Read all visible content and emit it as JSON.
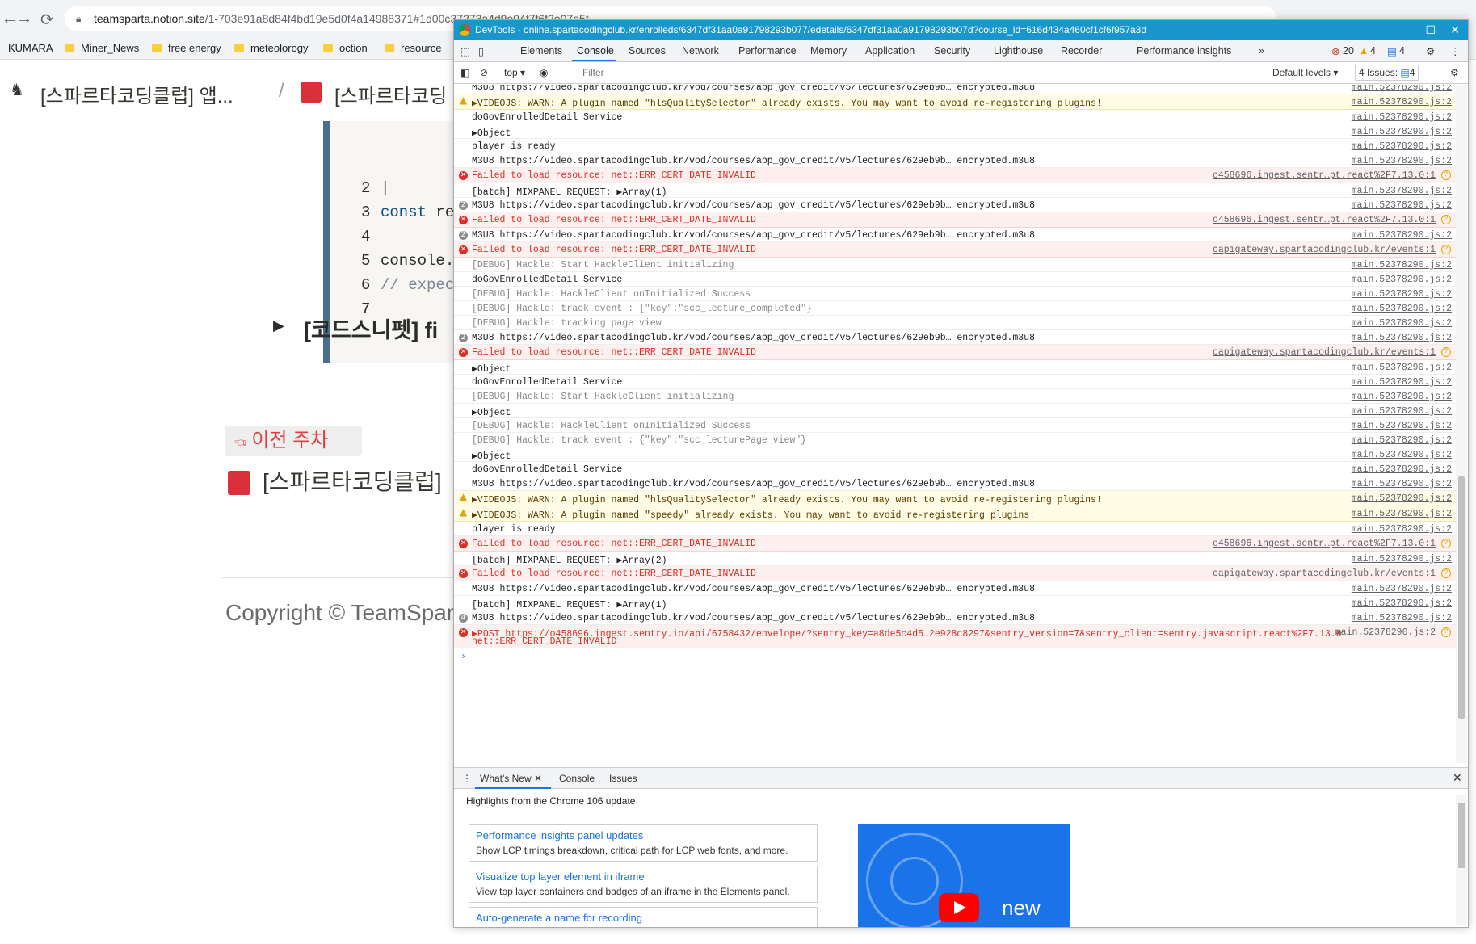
{
  "browser": {
    "url_host": "teamsparta.notion.site",
    "url_rest": "/1-703e91a8d84f4bd19e5d0f4a14988371#1d00c37273a4d9e94f7f6f2e07e5f",
    "bookmarks": [
      "KUMARA",
      "Miner_News",
      "free energy",
      "meteolorogy",
      "oction",
      "resource"
    ]
  },
  "notion": {
    "breadcrumb_1": "[스파르타코딩클럽] 앱...",
    "breadcrumb_sep": "/",
    "breadcrumb_2": "[스파르타코딩",
    "code_lines": [
      {
        "num": "2",
        "text": "|"
      },
      {
        "num": "3",
        "kw": "const",
        "text": " re"
      },
      {
        "num": "4",
        "text": ""
      },
      {
        "num": "5",
        "text": "console."
      },
      {
        "num": "6",
        "comment": "// expec"
      },
      {
        "num": "7",
        "text": ""
      }
    ],
    "toggle_text": "[코드스니펫] fi",
    "prev_week": "이전 주차",
    "prev_link": "[스파르타코딩클럽]",
    "copyright": "Copyright © TeamSpar"
  },
  "devtools": {
    "title": "DevTools - online.spartacodingclub.kr/enrolleds/6347df31aa0a91798293b077/edetails/6347df31aa0a91798293b07d?course_id=616d434a460cf1cf6f957a3d",
    "tabs": [
      "Elements",
      "Console",
      "Sources",
      "Network",
      "Performance",
      "Memory",
      "Application",
      "Security",
      "Lighthouse",
      "Recorder",
      "Performance insights"
    ],
    "more_tabs": "»",
    "error_count": "20",
    "warn_count": "4",
    "info_count": "4",
    "context": "top",
    "filter_placeholder": "Filter",
    "levels": "Default levels",
    "issues": "4 Issues:",
    "issues_count": "4",
    "rows": [
      {
        "type": "log",
        "text": "M3U8 https://video.spartacodingclub.kr/vod/courses/app_gov_credit/v5/lectures/629eb9b… encrypted.m3u8",
        "src": "main.52378290.js:2"
      },
      {
        "type": "warn",
        "text": "▶VIDEOJS: WARN: A plugin named \"hlsQualitySelector\" already exists. You may want to avoid re-registering plugins!",
        "src": "main.52378290.js:2"
      },
      {
        "type": "log",
        "text": "doGovEnrolledDetail Service",
        "src": "main.52378290.js:2"
      },
      {
        "type": "log",
        "text": "▶Object",
        "src": "main.52378290.js:2"
      },
      {
        "type": "log",
        "text": "player is ready",
        "src": "main.52378290.js:2"
      },
      {
        "type": "log",
        "text": "M3U8 https://video.spartacodingclub.kr/vod/courses/app_gov_credit/v5/lectures/629eb9b… encrypted.m3u8",
        "src": "main.52378290.js:2"
      },
      {
        "type": "err",
        "text": "Failed to load resource: net::ERR_CERT_DATE_INVALID",
        "src": "o458696.ingest.sentr…pt.react%2F7.13.0:1"
      },
      {
        "type": "log",
        "text": "[batch] MIXPANEL REQUEST: ▶Array(1)",
        "src": "main.52378290.js:2"
      },
      {
        "type": "log",
        "count": "2",
        "text": "M3U8 https://video.spartacodingclub.kr/vod/courses/app_gov_credit/v5/lectures/629eb9b… encrypted.m3u8",
        "src": "main.52378290.js:2"
      },
      {
        "type": "err",
        "text": "Failed to load resource: net::ERR_CERT_DATE_INVALID",
        "src": "o458696.ingest.sentr…pt.react%2F7.13.0:1"
      },
      {
        "type": "log",
        "count": "2",
        "text": "M3U8 https://video.spartacodingclub.kr/vod/courses/app_gov_credit/v5/lectures/629eb9b… encrypted.m3u8",
        "src": "main.52378290.js:2"
      },
      {
        "type": "err",
        "text": "Failed to load resource: net::ERR_CERT_DATE_INVALID",
        "src": "capigateway.spartacodingclub.kr/events:1"
      },
      {
        "type": "dbg",
        "text": "[DEBUG] Hackle: Start HackleClient initializing",
        "src": "main.52378290.js:2"
      },
      {
        "type": "log",
        "text": "doGovEnrolledDetail Service",
        "src": "main.52378290.js:2"
      },
      {
        "type": "dbg",
        "text": "[DEBUG] Hackle: HackleClient onInitialized Success",
        "src": "main.52378290.js:2"
      },
      {
        "type": "dbg",
        "text": "[DEBUG] Hackle: track event : {\"key\":\"scc_lecture_completed\"}",
        "src": "main.52378290.js:2"
      },
      {
        "type": "dbg",
        "text": "[DEBUG] Hackle: tracking page view",
        "src": "main.52378290.js:2"
      },
      {
        "type": "log",
        "count": "2",
        "text": "M3U8 https://video.spartacodingclub.kr/vod/courses/app_gov_credit/v5/lectures/629eb9b… encrypted.m3u8",
        "src": "main.52378290.js:2"
      },
      {
        "type": "err",
        "text": "Failed to load resource: net::ERR_CERT_DATE_INVALID",
        "src": "capigateway.spartacodingclub.kr/events:1"
      },
      {
        "type": "log",
        "text": "▶Object",
        "src": "main.52378290.js:2"
      },
      {
        "type": "log",
        "text": "doGovEnrolledDetail Service",
        "src": "main.52378290.js:2"
      },
      {
        "type": "dbg",
        "text": "[DEBUG] Hackle: Start HackleClient initializing",
        "src": "main.52378290.js:2"
      },
      {
        "type": "log",
        "text": "▶Object",
        "src": "main.52378290.js:2"
      },
      {
        "type": "dbg",
        "text": "[DEBUG] Hackle: HackleClient onInitialized Success",
        "src": "main.52378290.js:2"
      },
      {
        "type": "dbg",
        "text": "[DEBUG] Hackle: track event : {\"key\":\"scc_lecturePage_view\"}",
        "src": "main.52378290.js:2"
      },
      {
        "type": "log",
        "text": "▶Object",
        "src": "main.52378290.js:2"
      },
      {
        "type": "log",
        "text": "doGovEnrolledDetail Service",
        "src": "main.52378290.js:2"
      },
      {
        "type": "log",
        "text": "M3U8 https://video.spartacodingclub.kr/vod/courses/app_gov_credit/v5/lectures/629eb9b… encrypted.m3u8",
        "src": "main.52378290.js:2"
      },
      {
        "type": "warn",
        "text": "▶VIDEOJS: WARN: A plugin named \"hlsQualitySelector\" already exists. You may want to avoid re-registering plugins!",
        "src": "main.52378290.js:2"
      },
      {
        "type": "warn",
        "text": "▶VIDEOJS: WARN: A plugin named \"speedy\" already exists. You may want to avoid re-registering plugins!",
        "src": "main.52378290.js:2"
      },
      {
        "type": "log",
        "text": "player is ready",
        "src": "main.52378290.js:2"
      },
      {
        "type": "err",
        "text": "Failed to load resource: net::ERR_CERT_DATE_INVALID",
        "src": "o458696.ingest.sentr…pt.react%2F7.13.0:1"
      },
      {
        "type": "log",
        "text": "[batch] MIXPANEL REQUEST: ▶Array(2)",
        "src": "main.52378290.js:2"
      },
      {
        "type": "err",
        "text": "Failed to load resource: net::ERR_CERT_DATE_INVALID",
        "src": "capigateway.spartacodingclub.kr/events:1"
      },
      {
        "type": "log",
        "text": "M3U8 https://video.spartacodingclub.kr/vod/courses/app_gov_credit/v5/lectures/629eb9b… encrypted.m3u8",
        "src": "main.52378290.js:2"
      },
      {
        "type": "log",
        "text": "[batch] MIXPANEL REQUEST: ▶Array(1)",
        "src": "main.52378290.js:2"
      },
      {
        "type": "log",
        "count": "4",
        "text": "M3U8 https://video.spartacodingclub.kr/vod/courses/app_gov_credit/v5/lectures/629eb9b… encrypted.m3u8",
        "src": "main.52378290.js:2"
      },
      {
        "type": "err",
        "tall": true,
        "text": "▶POST https://o458696.ingest.sentry.io/api/6758432/envelope/?sentry_key=a8de5c4d5…2e928c8297&sentry_version=7&sentry_client=sentry.javascript.react%2F7.13.0",
        "text2": "net::ERR_CERT_DATE_INVALID",
        "src": "main.52378290.js:2"
      }
    ],
    "drawer_tabs": [
      "What's New",
      "Console",
      "Issues"
    ],
    "highlights": "Highlights from the Chrome 106 update",
    "cards": [
      {
        "title": "Performance insights panel updates",
        "desc": "Show LCP timings breakdown, critical path for LCP web fonts, and more."
      },
      {
        "title": "Visualize top layer element in iframe",
        "desc": "View top layer containers and badges of an iframe in the Elements panel."
      },
      {
        "title": "Auto-generate a name for recording",
        "desc": ""
      }
    ],
    "video_text": "new"
  }
}
